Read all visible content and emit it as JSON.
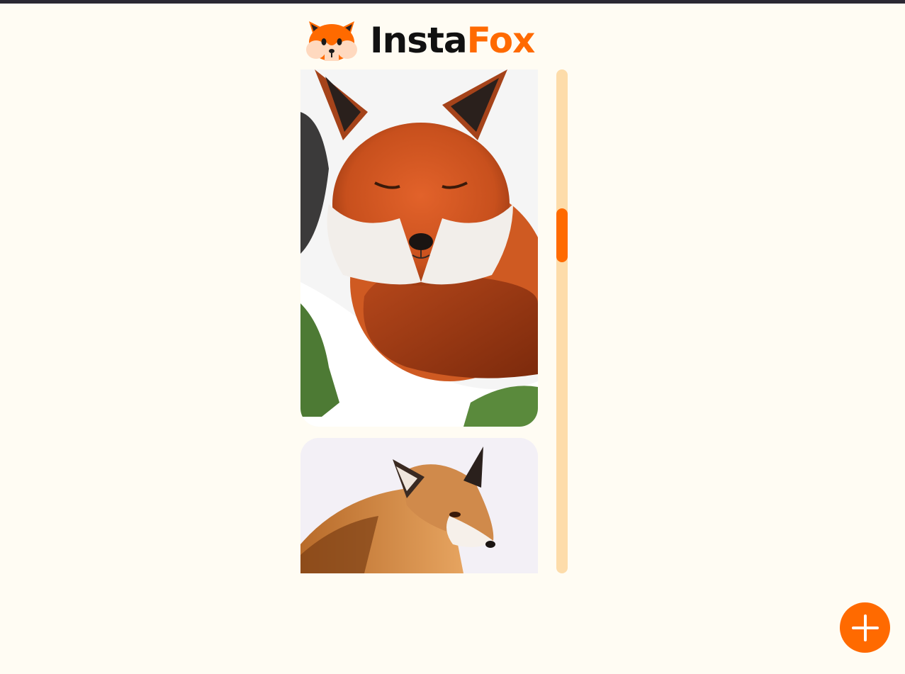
{
  "app": {
    "name_part1": "Insta",
    "name_part2": "Fox",
    "logo_icon": "fox-head-icon",
    "accent_color": "#ff6a00",
    "background_color": "#fffcf3"
  },
  "feed": {
    "posts": [
      {
        "image": "sleeping-red-fox-in-snow"
      },
      {
        "image": "red-fox-looking-back-on-snow"
      }
    ],
    "scroll": {
      "position_fraction": 0.33
    }
  },
  "fab": {
    "icon": "plus-icon"
  }
}
